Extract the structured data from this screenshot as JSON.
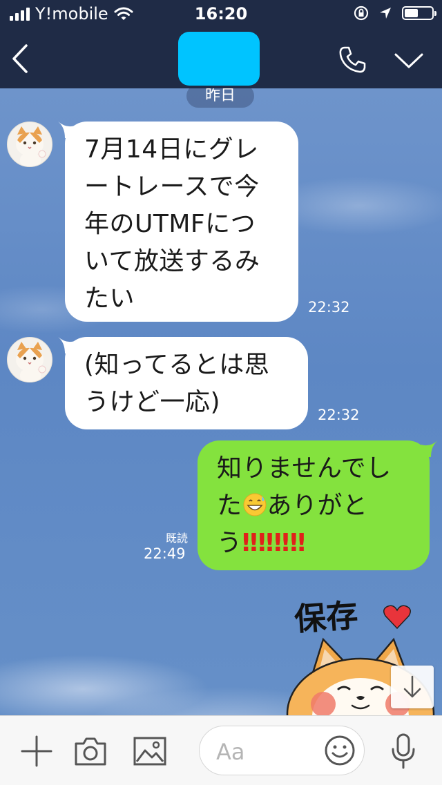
{
  "status_bar": {
    "carrier": "Y!mobile",
    "time": "16:20",
    "icons": [
      "signal-bars-icon",
      "wifi-icon",
      "orientation-lock-icon",
      "location-arrow-icon",
      "battery-icon"
    ],
    "battery_level": 0.5
  },
  "nav": {
    "back_icon": "chevron-left-icon",
    "call_icon": "phone-icon",
    "menu_icon": "chevron-down-icon",
    "title_redaction_color": "#00c4ff"
  },
  "chat": {
    "date_label": "昨日",
    "messages": [
      {
        "side": "incoming",
        "avatar": "cat-avatar",
        "lines": [
          "7月14日にグレ",
          "ートレースで今",
          "年のUTMFにつ",
          "いて放送するみ",
          "たい"
        ],
        "time": "22:32"
      },
      {
        "side": "incoming",
        "avatar": "cat-avatar",
        "lines": [
          "(知ってるとは思",
          "うけど一応)"
        ],
        "time": "22:32"
      },
      {
        "side": "outgoing",
        "line1": "知りませんでし",
        "line2_a": "た",
        "line2_emoji": "grinning-sweat-emoji",
        "line2_b": "ありがと",
        "line3_a": "う",
        "line3_excl": "‼‼‼‼",
        "read_label": "既読",
        "time": "22:49"
      }
    ],
    "sticker": {
      "caption": "保存",
      "heart_color": "#e8343b",
      "description": "shiba-dog-sticker"
    },
    "scroll_down_icon": "arrow-down-icon"
  },
  "input_bar": {
    "icons": [
      "plus-icon",
      "camera-icon",
      "image-icon",
      "emoji-icon",
      "microphone-icon"
    ],
    "placeholder": "Aa"
  },
  "colors": {
    "header_bg": "#1f2b46",
    "incoming_bubble": "#ffffff",
    "outgoing_bubble": "#84e23e",
    "exclamation": "#e0211a"
  }
}
